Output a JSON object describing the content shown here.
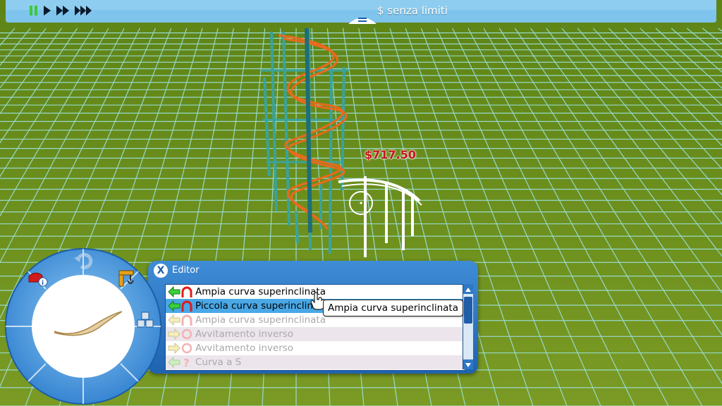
{
  "topbar": {
    "money": "$ senza limiti",
    "speed_buttons": [
      "pause-icon",
      "play-icon",
      "fast-forward-icon",
      "fastest-forward-icon"
    ]
  },
  "scene": {
    "price_label": "$717.50",
    "colors": {
      "grass": "#6b8f1e",
      "grid": "#9fe6e9",
      "track": "#e86a1c",
      "supports": "#3aa39a",
      "ghost": "#ffffff"
    }
  },
  "editor": {
    "close_label": "X",
    "title": "Editor",
    "items": [
      {
        "label": "Ampia curva superinclinata",
        "state": "enabled",
        "icon": "curve-icon"
      },
      {
        "label": "Piccola curva superinclinata",
        "state": "selected",
        "icon": "curve-icon"
      },
      {
        "label": "Ampia curva superinclinata",
        "state": "disabled",
        "icon": "curve-icon"
      },
      {
        "label": "Avvitamento inverso",
        "state": "disabled",
        "icon": "loop-icon"
      },
      {
        "label": "Avvitamento inverso",
        "state": "disabled",
        "icon": "loop-icon"
      },
      {
        "label": "Curva a S",
        "state": "disabled",
        "icon": "question-icon"
      }
    ],
    "tooltip": "Ampia curva superinclinata"
  },
  "wheel": {
    "buttons": [
      "ride-info-icon",
      "undo-icon",
      "crane-icon",
      "blocks-icon"
    ],
    "accent": "#3f8fd8"
  }
}
